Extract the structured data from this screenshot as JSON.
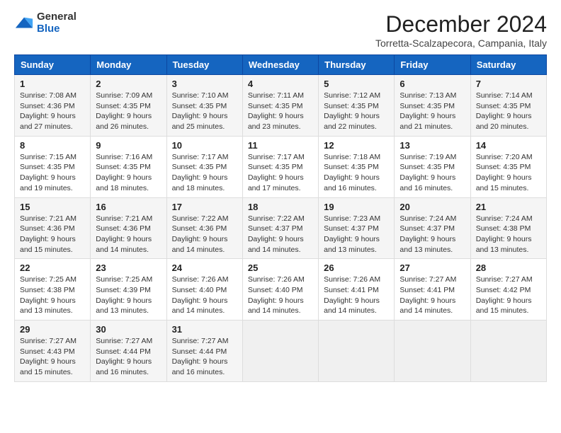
{
  "header": {
    "logo_general": "General",
    "logo_blue": "Blue",
    "title": "December 2024",
    "subtitle": "Torretta-Scalzapecora, Campania, Italy"
  },
  "columns": [
    "Sunday",
    "Monday",
    "Tuesday",
    "Wednesday",
    "Thursday",
    "Friday",
    "Saturday"
  ],
  "weeks": [
    [
      {
        "day": "1",
        "sunrise": "7:08 AM",
        "sunset": "4:36 PM",
        "daylight": "9 hours and 27 minutes."
      },
      {
        "day": "2",
        "sunrise": "7:09 AM",
        "sunset": "4:35 PM",
        "daylight": "9 hours and 26 minutes."
      },
      {
        "day": "3",
        "sunrise": "7:10 AM",
        "sunset": "4:35 PM",
        "daylight": "9 hours and 25 minutes."
      },
      {
        "day": "4",
        "sunrise": "7:11 AM",
        "sunset": "4:35 PM",
        "daylight": "9 hours and 23 minutes."
      },
      {
        "day": "5",
        "sunrise": "7:12 AM",
        "sunset": "4:35 PM",
        "daylight": "9 hours and 22 minutes."
      },
      {
        "day": "6",
        "sunrise": "7:13 AM",
        "sunset": "4:35 PM",
        "daylight": "9 hours and 21 minutes."
      },
      {
        "day": "7",
        "sunrise": "7:14 AM",
        "sunset": "4:35 PM",
        "daylight": "9 hours and 20 minutes."
      }
    ],
    [
      {
        "day": "8",
        "sunrise": "7:15 AM",
        "sunset": "4:35 PM",
        "daylight": "9 hours and 19 minutes."
      },
      {
        "day": "9",
        "sunrise": "7:16 AM",
        "sunset": "4:35 PM",
        "daylight": "9 hours and 18 minutes."
      },
      {
        "day": "10",
        "sunrise": "7:17 AM",
        "sunset": "4:35 PM",
        "daylight": "9 hours and 18 minutes."
      },
      {
        "day": "11",
        "sunrise": "7:17 AM",
        "sunset": "4:35 PM",
        "daylight": "9 hours and 17 minutes."
      },
      {
        "day": "12",
        "sunrise": "7:18 AM",
        "sunset": "4:35 PM",
        "daylight": "9 hours and 16 minutes."
      },
      {
        "day": "13",
        "sunrise": "7:19 AM",
        "sunset": "4:35 PM",
        "daylight": "9 hours and 16 minutes."
      },
      {
        "day": "14",
        "sunrise": "7:20 AM",
        "sunset": "4:35 PM",
        "daylight": "9 hours and 15 minutes."
      }
    ],
    [
      {
        "day": "15",
        "sunrise": "7:21 AM",
        "sunset": "4:36 PM",
        "daylight": "9 hours and 15 minutes."
      },
      {
        "day": "16",
        "sunrise": "7:21 AM",
        "sunset": "4:36 PM",
        "daylight": "9 hours and 14 minutes."
      },
      {
        "day": "17",
        "sunrise": "7:22 AM",
        "sunset": "4:36 PM",
        "daylight": "9 hours and 14 minutes."
      },
      {
        "day": "18",
        "sunrise": "7:22 AM",
        "sunset": "4:37 PM",
        "daylight": "9 hours and 14 minutes."
      },
      {
        "day": "19",
        "sunrise": "7:23 AM",
        "sunset": "4:37 PM",
        "daylight": "9 hours and 13 minutes."
      },
      {
        "day": "20",
        "sunrise": "7:24 AM",
        "sunset": "4:37 PM",
        "daylight": "9 hours and 13 minutes."
      },
      {
        "day": "21",
        "sunrise": "7:24 AM",
        "sunset": "4:38 PM",
        "daylight": "9 hours and 13 minutes."
      }
    ],
    [
      {
        "day": "22",
        "sunrise": "7:25 AM",
        "sunset": "4:38 PM",
        "daylight": "9 hours and 13 minutes."
      },
      {
        "day": "23",
        "sunrise": "7:25 AM",
        "sunset": "4:39 PM",
        "daylight": "9 hours and 13 minutes."
      },
      {
        "day": "24",
        "sunrise": "7:26 AM",
        "sunset": "4:40 PM",
        "daylight": "9 hours and 14 minutes."
      },
      {
        "day": "25",
        "sunrise": "7:26 AM",
        "sunset": "4:40 PM",
        "daylight": "9 hours and 14 minutes."
      },
      {
        "day": "26",
        "sunrise": "7:26 AM",
        "sunset": "4:41 PM",
        "daylight": "9 hours and 14 minutes."
      },
      {
        "day": "27",
        "sunrise": "7:27 AM",
        "sunset": "4:41 PM",
        "daylight": "9 hours and 14 minutes."
      },
      {
        "day": "28",
        "sunrise": "7:27 AM",
        "sunset": "4:42 PM",
        "daylight": "9 hours and 15 minutes."
      }
    ],
    [
      {
        "day": "29",
        "sunrise": "7:27 AM",
        "sunset": "4:43 PM",
        "daylight": "9 hours and 15 minutes."
      },
      {
        "day": "30",
        "sunrise": "7:27 AM",
        "sunset": "4:44 PM",
        "daylight": "9 hours and 16 minutes."
      },
      {
        "day": "31",
        "sunrise": "7:27 AM",
        "sunset": "4:44 PM",
        "daylight": "9 hours and 16 minutes."
      },
      null,
      null,
      null,
      null
    ]
  ],
  "labels": {
    "sunrise_prefix": "Sunrise: ",
    "sunset_prefix": "Sunset: ",
    "daylight_prefix": "Daylight: "
  }
}
